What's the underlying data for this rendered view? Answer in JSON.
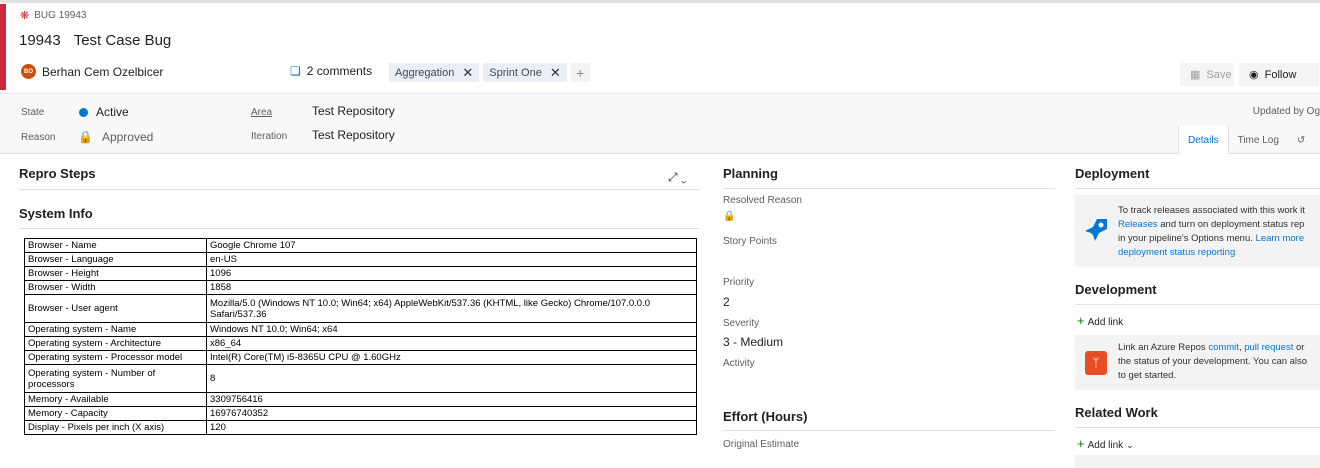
{
  "header": {
    "type_label": "BUG 19943",
    "id": "19943",
    "title": "Test Case Bug",
    "assignee": "Berhan Cem Ozelbicer",
    "assignee_initials": "BO",
    "comments": "2 comments",
    "tags": [
      "Aggregation",
      "Sprint One"
    ],
    "save_label": "Save",
    "follow_label": "Follow",
    "accent_color": "#cc293d"
  },
  "fields": {
    "state_label": "State",
    "state_value": "Active",
    "reason_label": "Reason",
    "reason_value": "Approved",
    "area_label": "Area",
    "area_value": "Test Repository",
    "iteration_label": "Iteration",
    "iteration_value": "Test Repository",
    "updated": "Updated by Og"
  },
  "tabs": [
    "Details",
    "Time Log"
  ],
  "left": {
    "repro_title": "Repro Steps",
    "sysinfo_title": "System Info",
    "rows": [
      [
        "Browser - Name",
        "Google Chrome 107"
      ],
      [
        "Browser - Language",
        "en-US"
      ],
      [
        "Browser - Height",
        "1096"
      ],
      [
        "Browser - Width",
        "1858"
      ],
      [
        "Browser - User agent",
        "Mozilla/5.0 (Windows NT 10.0; Win64; x64) AppleWebKit/537.36 (KHTML, like Gecko) Chrome/107.0.0.0 Safari/537.36"
      ],
      [
        "Operating system - Name",
        "Windows NT 10.0; Win64; x64"
      ],
      [
        "Operating system - Architecture",
        "x86_64"
      ],
      [
        "Operating system - Processor model",
        "Intel(R) Core(TM) i5-8365U CPU @ 1.60GHz"
      ],
      [
        "Operating system - Number of processors",
        "8"
      ],
      [
        "Memory - Available",
        "3309756416"
      ],
      [
        "Memory - Capacity",
        "16976740352"
      ],
      [
        "Display - Pixels per inch (X axis)",
        "120"
      ]
    ]
  },
  "planning": {
    "title": "Planning",
    "resolved_reason_label": "Resolved Reason",
    "story_points_label": "Story Points",
    "priority_label": "Priority",
    "priority_value": "2",
    "severity_label": "Severity",
    "severity_value": "3 - Medium",
    "activity_label": "Activity",
    "effort_title": "Effort (Hours)",
    "original_estimate_label": "Original Estimate"
  },
  "right": {
    "deployment_title": "Deployment",
    "deploy_line1": "To track releases associated with this work it",
    "deploy_link1": "Releases",
    "deploy_line2_rest": " and turn on deployment status rep",
    "deploy_line3": "in your pipeline's Options menu. ",
    "deploy_link2": "Learn more",
    "deploy_link3": "deployment status reporting",
    "development_title": "Development",
    "add_link": "Add link",
    "dev_line1_a": "Link an Azure Repos ",
    "dev_link_commit": "commit",
    "dev_comma": ", ",
    "dev_link_pr": "pull request",
    "dev_line1_b": " or",
    "dev_line2": "the status of your development. You can also",
    "dev_line3": "to get started.",
    "related_title": "Related Work",
    "add_link_dropdown": "Add link"
  }
}
